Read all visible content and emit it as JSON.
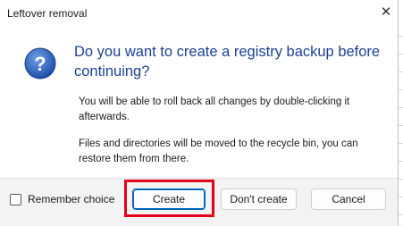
{
  "window": {
    "title": "Leftover removal",
    "close_glyph": "✕"
  },
  "message": {
    "heading": "Do you want to create a registry backup before continuing?",
    "paragraph1": "You will be able to roll back all changes by double-clicking it afterwards.",
    "paragraph2": "Files and directories will be moved to the recycle bin, you can restore them from there."
  },
  "icon": {
    "name": "question-icon",
    "glyph": "?",
    "color": "#2a5fb8"
  },
  "footer": {
    "checkbox_label": "Remember choice",
    "checkbox_checked": false,
    "buttons": {
      "create": "Create",
      "dont_create": "Don't create",
      "cancel": "Cancel"
    }
  },
  "annotation": {
    "highlight_color": "#e3001b"
  }
}
